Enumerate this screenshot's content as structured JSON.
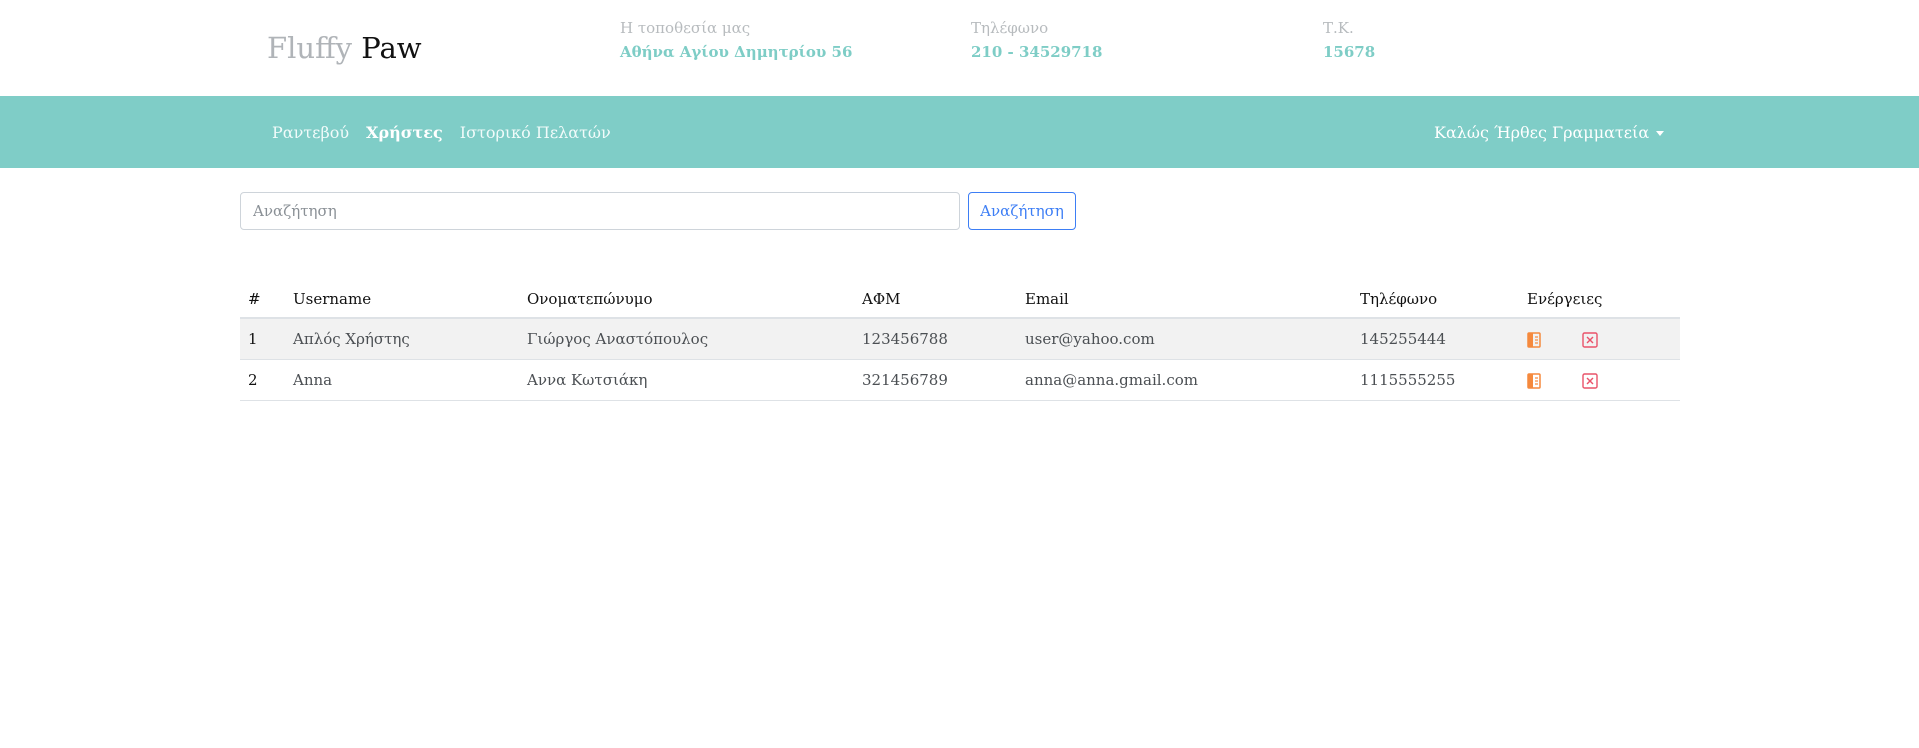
{
  "brand": {
    "part1": "Fluffy",
    "part2": "Paw"
  },
  "header_info": [
    {
      "label": "Η τοποθεσία μας",
      "value": "Αθήνα Αγίου Δημητρίου 56"
    },
    {
      "label": "Τηλέφωνο",
      "value": "210 - 34529718"
    },
    {
      "label": "Τ.Κ.",
      "value": "15678"
    }
  ],
  "nav": {
    "links": [
      {
        "label": "Ραντεβού",
        "active": false
      },
      {
        "label": "Χρήστες",
        "active": true
      },
      {
        "label": "Ιστορικό Πελατών",
        "active": false
      }
    ],
    "user_menu": "Καλώς Ήρθες Γραμματεία"
  },
  "search": {
    "placeholder": "Αναζήτηση",
    "value": "",
    "button_label": "Αναζήτηση"
  },
  "table": {
    "headers": [
      "#",
      "Username",
      "Ονοματεπώνυμο",
      "ΑΦΜ",
      "Email",
      "Τηλέφωνο",
      "Ενέργειες"
    ],
    "rows": [
      [
        "1",
        "Απλός Χρήστης",
        "Γιώργος Αναστόπουλος",
        "123456788",
        "user@yahoo.com",
        "145255444"
      ],
      [
        "2",
        "Anna",
        "Αννα Κωτσιάκη",
        "321456789",
        "anna@anna.gmail.com",
        "1115555255"
      ]
    ],
    "actions": {
      "edit_icon": "edit-note-icon",
      "delete_icon": "close-box-icon"
    }
  },
  "colors": {
    "brand_teal": "#7fcdc7",
    "info_value": "#7ecdc6",
    "primary_blue": "#3d7ef5",
    "edit_orange": "#f5893d",
    "delete_red": "#e9536a"
  }
}
